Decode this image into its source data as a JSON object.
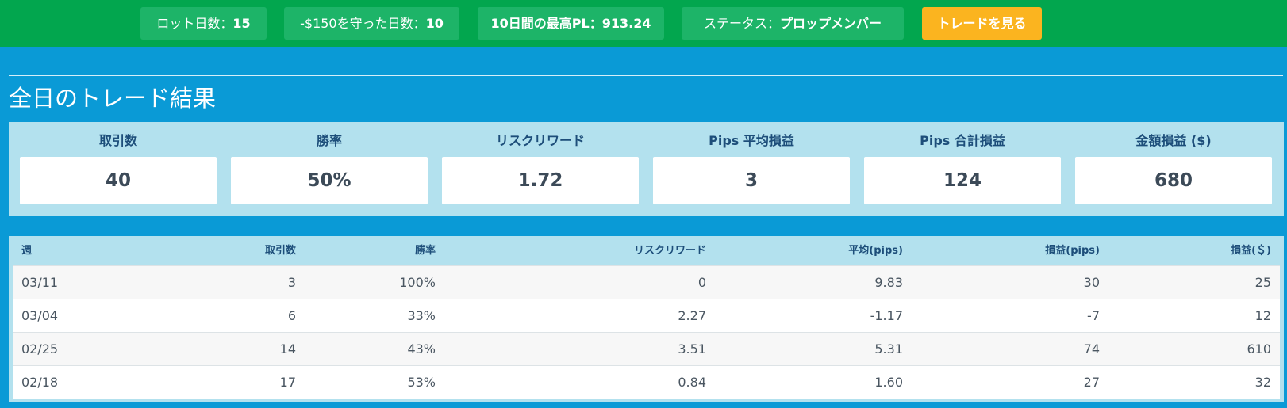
{
  "topbar": {
    "lot_days": {
      "label": "ロット日数：",
      "value": "15"
    },
    "kept_days": {
      "label": "-$150を守った日数：",
      "value": "10"
    },
    "max_pl": {
      "label": "10日間の最高PL：",
      "value": "913.24"
    },
    "status": {
      "label": "ステータス：",
      "value": "プロップメンバー"
    },
    "view_trades_label": "トレードを見る"
  },
  "section_title": "全日のトレード結果",
  "summary": [
    {
      "label": "取引数",
      "value": "40"
    },
    {
      "label": "勝率",
      "value": "50%"
    },
    {
      "label": "リスクリワード",
      "value": "1.72"
    },
    {
      "label": "Pips 平均損益",
      "value": "3"
    },
    {
      "label": "Pips 合計損益",
      "value": "124"
    },
    {
      "label": "金額損益 ($)",
      "value": "680"
    }
  ],
  "table": {
    "headers": [
      "週",
      "取引数",
      "勝率",
      "リスクリワード",
      "平均(pips)",
      "損益(pips)",
      "損益(＄)"
    ],
    "rows": [
      [
        "03/11",
        "3",
        "100%",
        "0",
        "9.83",
        "30",
        "25"
      ],
      [
        "03/04",
        "6",
        "33%",
        "2.27",
        "-1.17",
        "-7",
        "12"
      ],
      [
        "02/25",
        "14",
        "43%",
        "3.51",
        "5.31",
        "74",
        "610"
      ],
      [
        "02/18",
        "17",
        "53%",
        "0.84",
        "1.60",
        "27",
        "32"
      ]
    ]
  },
  "colors": {
    "topbar_bg": "#02a64e",
    "pill_bg": "#1db468",
    "button_bg": "#fbb41f",
    "page_bg": "#0a9ad6",
    "panel_bg": "#b3e1ee",
    "header_text": "#1d4e7a"
  }
}
